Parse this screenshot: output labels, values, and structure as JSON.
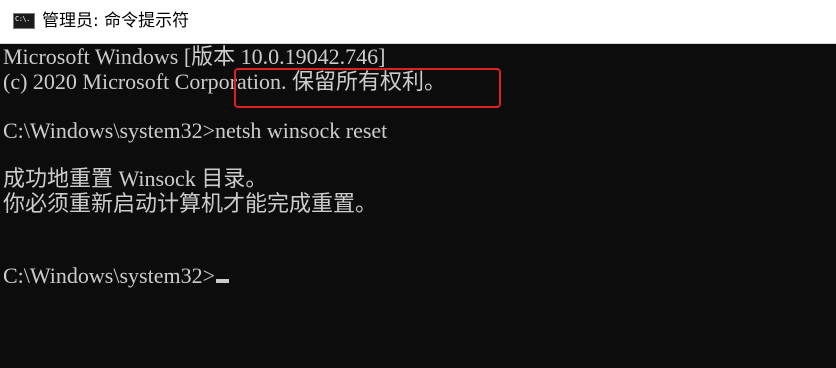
{
  "window": {
    "title": "管理员: 命令提示符",
    "icon": "cmd-icon",
    "icon_text": "C:\\."
  },
  "console": {
    "lines": [
      "Microsoft Windows [版本 10.0.19042.746]",
      "(c) 2020 Microsoft Corporation. 保留所有权利。",
      "",
      "C:\\Windows\\system32>netsh winsock reset",
      "",
      "成功地重置 Winsock 目录。",
      "你必须重新启动计算机才能完成重置。",
      "",
      "",
      "C:\\Windows\\system32>"
    ]
  },
  "colors": {
    "background": "#0c0c0c",
    "text": "#cccccc",
    "highlight_border": "#e02020"
  }
}
